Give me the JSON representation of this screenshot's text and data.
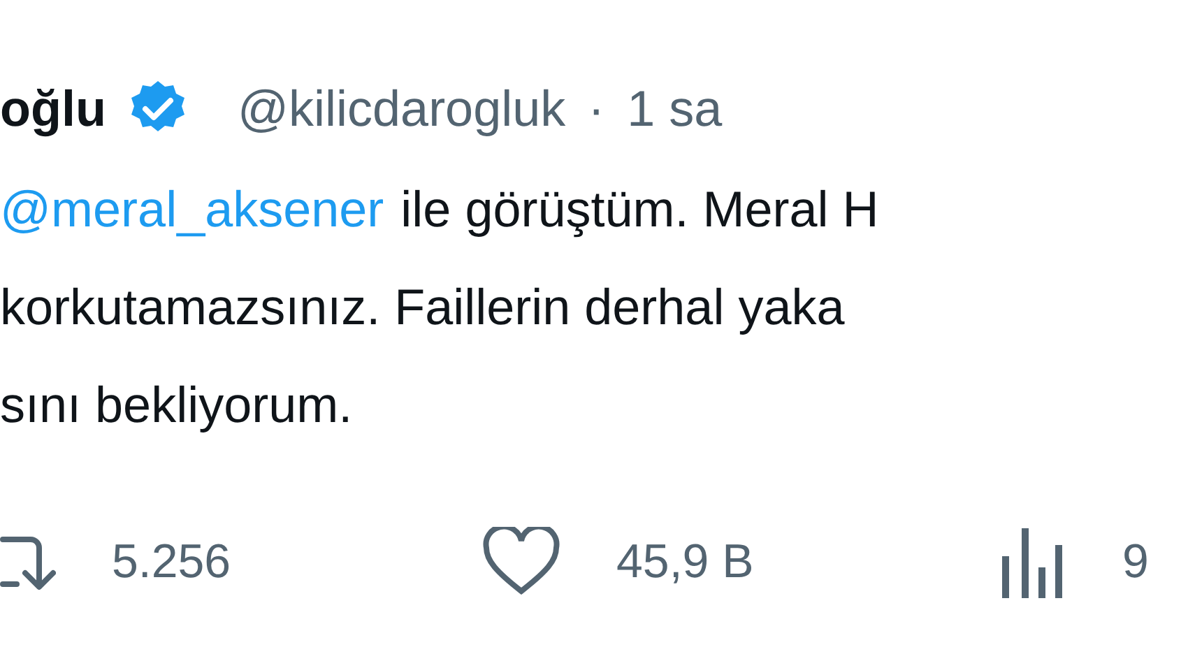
{
  "tweet": {
    "name": "oğlu",
    "verified": true,
    "handle": "@kilicdarogluk",
    "separator": "·",
    "time": "1 sa",
    "lines": [
      {
        "mention": "@meral_aksener",
        "text": "ile görüştüm. Meral H"
      },
      {
        "text": "korkutamazsınız. Faillerin derhal yaka"
      },
      {
        "text": "sını bekliyorum."
      }
    ],
    "actions": [
      {
        "kind": "retweet",
        "count": "5.256"
      },
      {
        "kind": "like",
        "count": "45,9 B"
      },
      {
        "kind": "views",
        "count": "9"
      }
    ]
  }
}
